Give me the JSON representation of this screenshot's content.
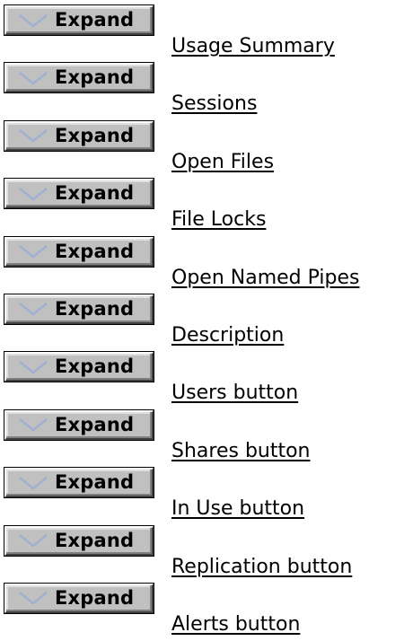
{
  "expand_label": "Expand",
  "colors": {
    "button_face": "#c0c0c0",
    "chevron": "#a0b0d0",
    "text": "#000000"
  },
  "icons": {
    "expand": "chevron-down-icon"
  },
  "items": [
    {
      "label": "Usage Summary"
    },
    {
      "label": "Sessions"
    },
    {
      "label": "Open Files"
    },
    {
      "label": "File Locks"
    },
    {
      "label": "Open Named Pipes"
    },
    {
      "label": "Description"
    },
    {
      "label": "Users button"
    },
    {
      "label": "Shares button"
    },
    {
      "label": "In Use button"
    },
    {
      "label": "Replication button"
    },
    {
      "label": "Alerts button"
    }
  ]
}
